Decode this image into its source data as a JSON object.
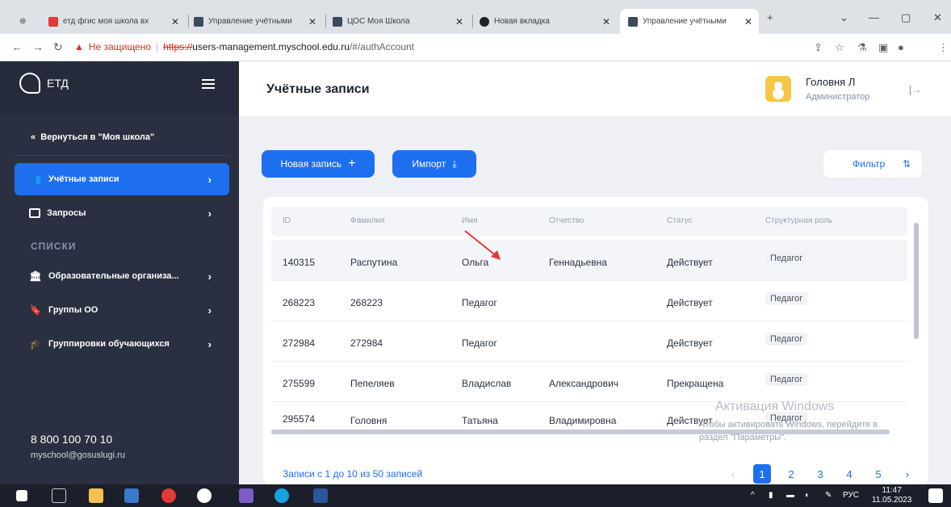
{
  "browser": {
    "tabs": [
      {
        "title": "етд фгис моя школа вх",
        "icon": "yandex-icon",
        "color": "#e53935",
        "active": false
      },
      {
        "title": "Управление учётными",
        "icon": "site-icon",
        "color": "#3c4a5e",
        "active": false
      },
      {
        "title": "ЦОС Моя Школа",
        "icon": "site-icon",
        "color": "#3c4a5e",
        "active": false
      },
      {
        "title": "Новая вкладка",
        "icon": "chrome-c-icon",
        "color": "#202124",
        "active": false
      },
      {
        "title": "Управление учётными",
        "icon": "site-icon",
        "color": "#3c4a5e",
        "active": true
      }
    ],
    "new_tab": "+",
    "security_label": "Не защищено",
    "url_https": "https://",
    "url_host": "users-management.myschool.edu.ru",
    "url_path": "/#/authAccount"
  },
  "sidebar": {
    "brand": "ЕТД",
    "back_link": "Вернуться в \"Моя школа\"",
    "items": [
      {
        "label": "Учётные записи",
        "icon": "users-icon",
        "active": true
      },
      {
        "label": "Запросы",
        "icon": "monitor-icon",
        "active": false
      }
    ],
    "section_title": "СПИСКИ",
    "list_items": [
      {
        "label": "Образовательные организа...",
        "icon": "institution-icon"
      },
      {
        "label": "Группы ОО",
        "icon": "bookmark-icon"
      },
      {
        "label": "Группировки обучающихся",
        "icon": "graduation-cap-icon"
      }
    ],
    "phone": "8 800 100 70 10",
    "email": "myschool@gosuslugi.ru"
  },
  "header": {
    "title": "Учётные записи",
    "user_name": "Головня Л",
    "user_role": "Администратор"
  },
  "toolbar": {
    "new_record": "Новая запись",
    "import": "Импорт",
    "filter": "Фильтр"
  },
  "table": {
    "columns": [
      "ID",
      "Фамилия",
      "Имя",
      "Отчество",
      "Статус",
      "Структурная роль"
    ],
    "rows": [
      {
        "id": "140315",
        "last": "Распутина",
        "first": "Ольга",
        "middle": "Геннадьевна",
        "status": "Действует",
        "role": "Педагог"
      },
      {
        "id": "268223",
        "last": "268223",
        "first": "Педагог",
        "middle": "",
        "status": "Действует",
        "role": "Педагог"
      },
      {
        "id": "272984",
        "last": "272984",
        "first": "Педагог",
        "middle": "",
        "status": "Действует",
        "role": "Педагог"
      },
      {
        "id": "275599",
        "last": "Пепеляев",
        "first": "Владислав",
        "middle": "Александрович",
        "status": "Прекращена",
        "role": "Педагог"
      },
      {
        "id": "295574",
        "last": "Головня",
        "first": "Татьяна",
        "middle": "Владимировна",
        "status": "Действует",
        "role": "Педагог"
      }
    ],
    "records_info": "Записи с 1 до 10 из 50 записей",
    "pages": [
      "1",
      "2",
      "3",
      "4",
      "5"
    ],
    "current_page": "1"
  },
  "watermark": {
    "title": "Активация Windows",
    "line1": "Чтобы активировать Windows, перейдите в",
    "line2": "раздел \"Параметры\"."
  },
  "taskbar": {
    "lang": "РУС",
    "time": "11:47",
    "date": "11.05.2023"
  },
  "colors": {
    "accent": "#1e6ff0",
    "sidebar": "#2a3041",
    "annotation_arrow": "#e53935"
  }
}
